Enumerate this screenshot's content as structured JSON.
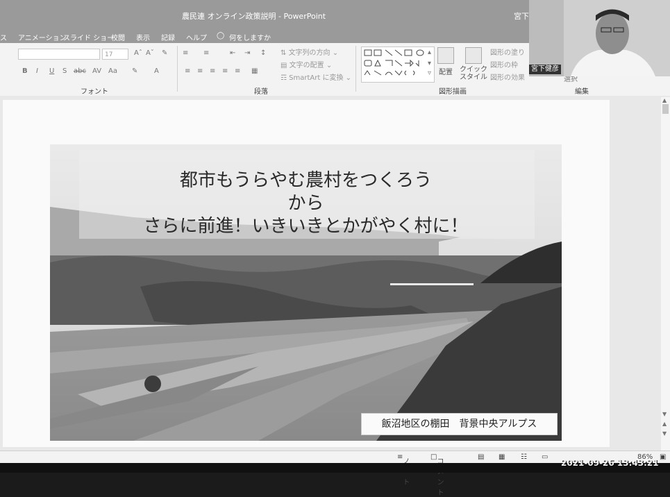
{
  "window": {
    "title": "農民連 オンライン政策説明",
    "app": "PowerPoint",
    "user": "宮下"
  },
  "tabs": [
    "ス",
    "アニメーション",
    "スライド ショー",
    "校閲",
    "表示",
    "記録",
    "ヘルプ",
    "何をしますか"
  ],
  "ribbon": {
    "font_size": "17",
    "groups": {
      "font": "フォント",
      "paragraph": "段落",
      "drawing": "図形描画",
      "editing": "編集"
    },
    "paragraph_items": [
      "文字列の方向",
      "文字の配置",
      "SmartArt に変換"
    ],
    "arrange_label": "配置",
    "quick_style_label": "クイック スタイル",
    "shape_items": [
      "図形の塗り",
      "図形の枠",
      "図形の効果"
    ],
    "select_label": "選択"
  },
  "slide": {
    "title_lines": [
      "都市もうらやむ農村をつくろう",
      "から",
      "さらに前進！いきいきとかがやく村に！"
    ],
    "caption": "飯沼地区の棚田　背景中央アルプス"
  },
  "status": {
    "notes": "ノート",
    "comments": "コメント",
    "zoom": "86%"
  },
  "webcam": {
    "name": "宮下健彦"
  },
  "timestamp": "2021-09-26  13:43:21"
}
